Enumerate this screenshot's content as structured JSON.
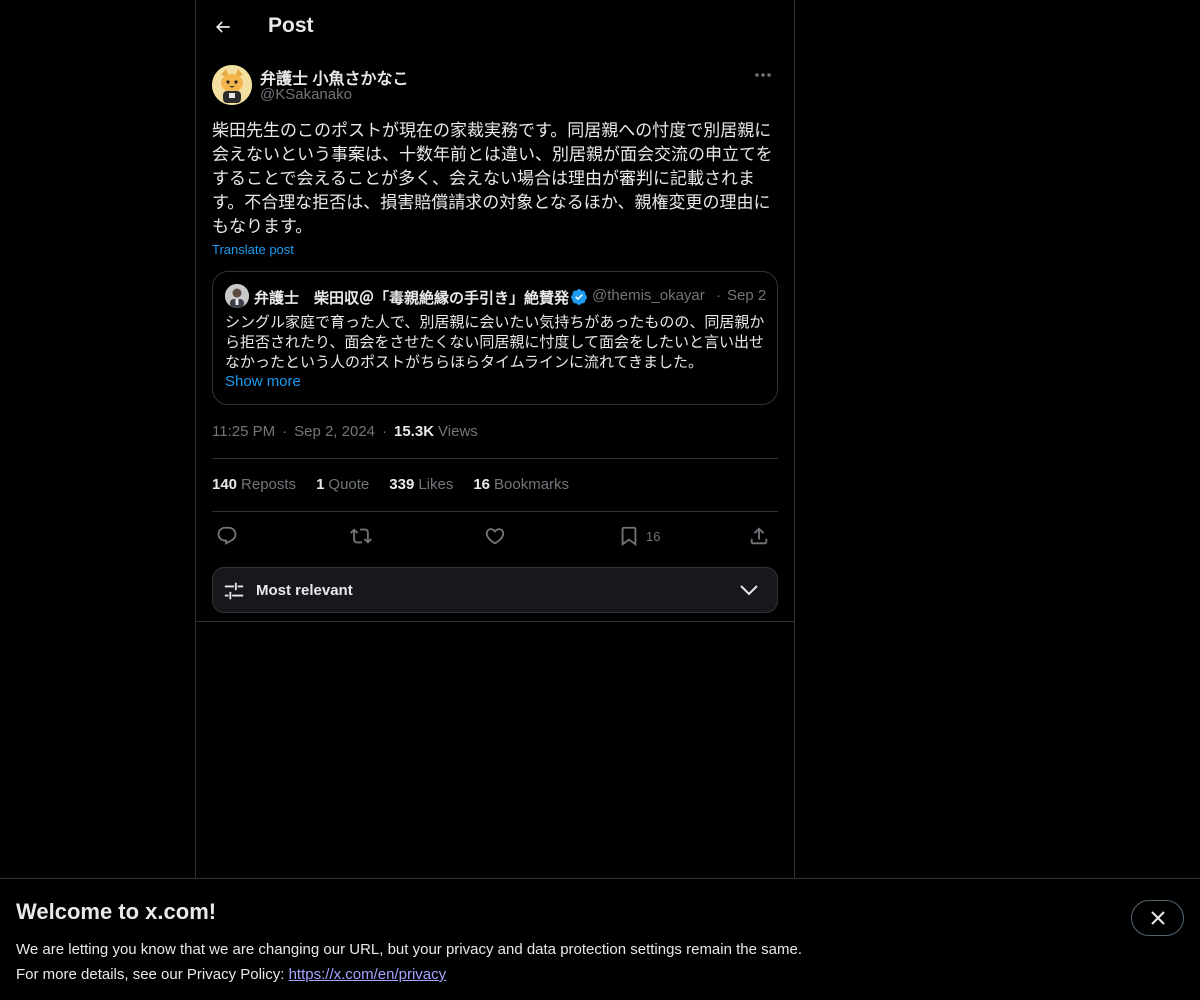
{
  "header": {
    "title": "Post",
    "back_icon": "arrow-left-icon"
  },
  "post": {
    "author_name": "弁護士 小魚さかなこ",
    "author_handle": "@KSakanako",
    "text": "柴田先生のこのポストが現在の家裁実務です。同居親への忖度で別居親に\n会えないという事案は、十数年前とは違い、別居親が面会交流の申立てを\nすることで会えることが多く、会えない場合は理由が審判に記載されま\nす。不合理な拒否は、損害賠償請求の対象となるほか、親権変更の理由に\nもなります。",
    "translate_label": "Translate post",
    "time": "11:25 PM",
    "date": "Sep 2, 2024",
    "views_count": "15.3K",
    "views_label": "Views",
    "separator": "·"
  },
  "quote": {
    "author_name": "弁護士　柴田収＠「毒親絶縁の手引き」絶賛発",
    "author_handle": "@themis_okayar",
    "separator": "·",
    "date": "Sep 2",
    "text": "シングル家庭で育った人で、別居親に会いたい気持ちがあったものの、同居親か\nら拒否されたり、面会をさせたくない同居親に忖度して面会をしたいと言い出せ\nなかったという人のポストがちらほらタイムラインに流れてきました。",
    "show_more": "Show more",
    "verified_color": "#1d9bf0"
  },
  "stats": [
    {
      "count": "140",
      "label": "Reposts"
    },
    {
      "count": "1",
      "label": "Quote"
    },
    {
      "count": "339",
      "label": "Likes"
    },
    {
      "count": "16",
      "label": "Bookmarks"
    }
  ],
  "actions": {
    "reply_icon": "reply-icon",
    "repost_icon": "repost-icon",
    "like_icon": "heart-icon",
    "bookmark_icon": "bookmark-icon",
    "bookmark_count": "16",
    "share_icon": "share-icon"
  },
  "sort": {
    "label": "Most relevant"
  },
  "banner": {
    "title": "Welcome to x.com!",
    "line1": "We are letting you know that we are changing our URL, but your privacy and data protection settings remain the same.",
    "line2_prefix": "For more details, see our Privacy Policy: ",
    "link": "https://x.com/en/privacy"
  },
  "colors": {
    "background": "#000000",
    "text": "#e7e9ea",
    "muted": "#71767b",
    "accent": "#1d9bf0",
    "border": "#2f3336",
    "link": "#a4a5ff"
  }
}
